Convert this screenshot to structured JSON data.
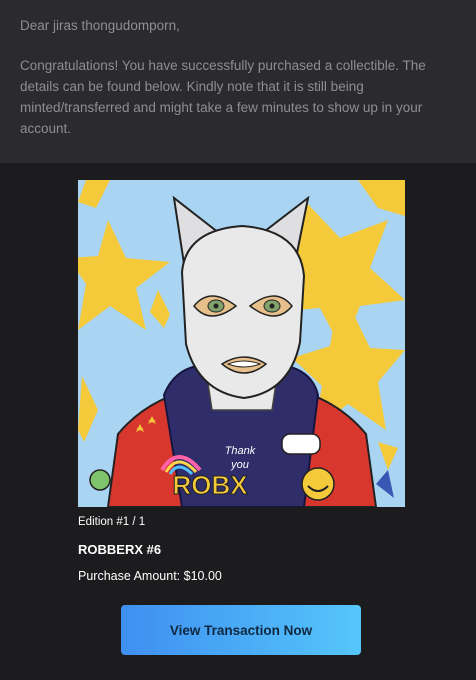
{
  "email": {
    "greeting": "Dear jiras thongudomporn,",
    "message": "Congratulations! You have successfully purchased a collectible. The details can be found below. Kindly note that it is still being minted/transferred and might take a few minutes to show up in your account."
  },
  "collectible": {
    "image_icon": "robber-cat-mask-character-art",
    "edition": "Edition #1 / 1",
    "name": "ROBBERX #6",
    "purchase_amount": "Purchase Amount: $10.00",
    "art_texts": {
      "chest_logo": "ROBX",
      "shirt_line1": "Thank",
      "shirt_line2": "you"
    }
  },
  "actions": {
    "view_transaction_label": "View Transaction Now"
  },
  "colors": {
    "background": "#1c1c1e",
    "header_background": "#2b2b2d",
    "body_text": "#8e8e93",
    "accent_gradient_start": "#3f8ff0",
    "accent_gradient_end": "#55c6fb",
    "art_background": "#a9d5f3",
    "art_stars": "#f4c93a",
    "jacket_red": "#d8372e",
    "hoodie_navy": "#2f2d6a"
  }
}
